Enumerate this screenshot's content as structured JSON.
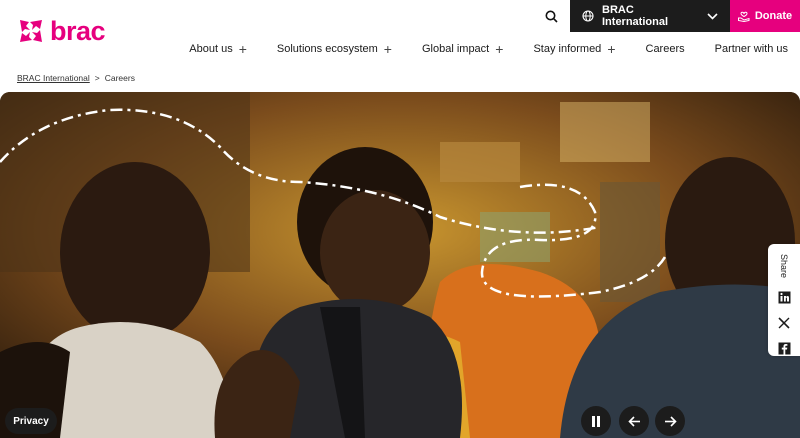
{
  "brand": {
    "name": "brac",
    "accent": "#e6007e",
    "dark": "#1c1c1c"
  },
  "topbar": {
    "search_icon": "search-icon",
    "site_select": "BRAC International",
    "donate_label": "Donate"
  },
  "nav": {
    "items": [
      {
        "label": "About us",
        "expandable": true
      },
      {
        "label": "Solutions ecosystem",
        "expandable": true
      },
      {
        "label": "Global impact",
        "expandable": true
      },
      {
        "label": "Stay informed",
        "expandable": true
      },
      {
        "label": "Careers",
        "expandable": false
      },
      {
        "label": "Partner with us",
        "expandable": false
      }
    ]
  },
  "breadcrumb": {
    "home": "BRAC International",
    "separator": ">",
    "current": "Careers"
  },
  "share": {
    "label": "Share",
    "icons": [
      "linkedin-icon",
      "x-icon",
      "facebook-icon"
    ]
  },
  "privacy_label": "Privacy",
  "carousel": {
    "controls": [
      "pause-icon",
      "arrow-left-icon",
      "arrow-right-icon"
    ]
  }
}
